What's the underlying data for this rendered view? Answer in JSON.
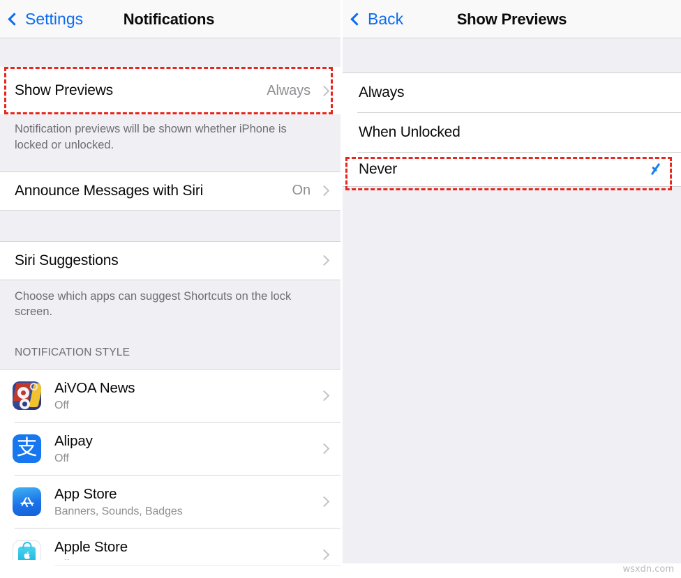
{
  "left_panel": {
    "nav": {
      "back_label": "Settings",
      "back_icon": "chevron-left-icon",
      "title": "Notifications"
    },
    "show_previews_row": {
      "label": "Show Previews",
      "value": "Always",
      "chevron_icon": "chevron-right-icon",
      "highlighted": true
    },
    "show_previews_footnote": "Notification previews will be shown whether iPhone is locked or unlocked.",
    "announce_row": {
      "label": "Announce Messages with Siri",
      "value": "On",
      "chevron_icon": "chevron-right-icon"
    },
    "siri_suggestions_row": {
      "label": "Siri Suggestions",
      "value": "",
      "chevron_icon": "chevron-right-icon"
    },
    "siri_suggestions_footnote": "Choose which apps can suggest Shortcuts on the lock screen.",
    "notification_style_header": "NOTIFICATION STYLE",
    "apps": [
      {
        "name": "AiVOA News",
        "status": "Off",
        "icon": "aivoa-news-app-icon",
        "chevron_icon": "chevron-right-icon"
      },
      {
        "name": "Alipay",
        "status": "Off",
        "icon": "alipay-app-icon",
        "chevron_icon": "chevron-right-icon"
      },
      {
        "name": "App Store",
        "status": "Banners, Sounds, Badges",
        "icon": "app-store-app-icon",
        "chevron_icon": "chevron-right-icon"
      },
      {
        "name": "Apple Store",
        "status": "Off",
        "icon": "apple-store-app-icon",
        "chevron_icon": "chevron-right-icon"
      }
    ]
  },
  "right_panel": {
    "nav": {
      "back_label": "Back",
      "back_icon": "chevron-left-icon",
      "title": "Show Previews"
    },
    "options": [
      {
        "label": "Always",
        "selected": false,
        "highlighted": false
      },
      {
        "label": "When Unlocked",
        "selected": false,
        "highlighted": false
      },
      {
        "label": "Never",
        "selected": true,
        "highlighted": true
      }
    ]
  },
  "watermark": "wsxdn.com",
  "colors": {
    "accent_blue": "#0b6bf2",
    "checkmark_blue": "#1a7ef0",
    "highlight_red": "#e8261c",
    "group_background": "#efeff4",
    "secondary_text": "#8e8e93"
  }
}
